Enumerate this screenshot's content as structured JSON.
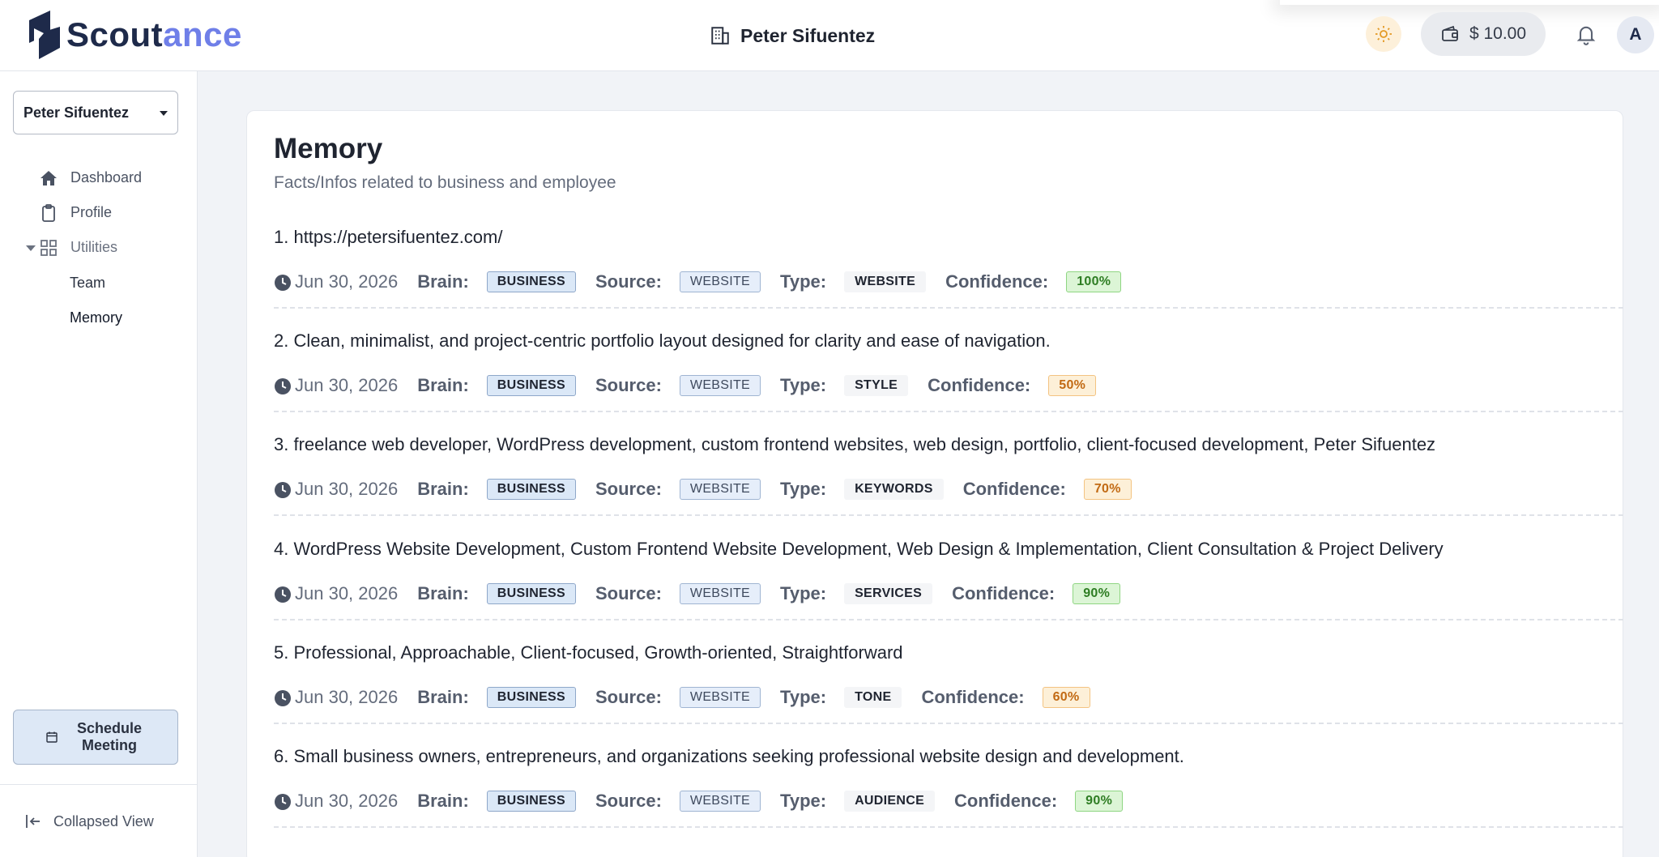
{
  "brand": {
    "name_part1": "Scout",
    "name_part2": "ance"
  },
  "header": {
    "company_name": "Peter Sifuentez",
    "wallet_balance": "$ 10.00",
    "avatar_initial": "A"
  },
  "sidebar": {
    "business_select": "Peter Sifuentez",
    "nav": [
      {
        "label": "Dashboard",
        "icon": "home-icon"
      },
      {
        "label": "Profile",
        "icon": "clipboard-icon"
      },
      {
        "label": "Utilities",
        "icon": "grid-icon"
      }
    ],
    "sub_items": [
      {
        "label": "Team"
      },
      {
        "label": "Memory"
      }
    ],
    "schedule_label": "Schedule Meeting",
    "collapse_label": "Collapsed View"
  },
  "page": {
    "title": "Memory",
    "subtitle": "Facts/Infos related to business and employee"
  },
  "labels": {
    "brain": "Brain:",
    "source": "Source:",
    "type": "Type:",
    "confidence": "Confidence:"
  },
  "memories": [
    {
      "text": "1. https://petersifuentez.com/",
      "date": "Jun 30, 2026",
      "brain": "BUSINESS",
      "source": "WEBSITE",
      "type": "WEBSITE",
      "confidence": "100%",
      "level": "green"
    },
    {
      "text": "2. Clean, minimalist, and project-centric portfolio layout designed for clarity and ease of navigation.",
      "date": "Jun 30, 2026",
      "brain": "BUSINESS",
      "source": "WEBSITE",
      "type": "STYLE",
      "confidence": "50%",
      "level": "orange"
    },
    {
      "text": "3. freelance web developer, WordPress development, custom frontend websites, web design, portfolio, client-focused development, Peter Sifuentez",
      "date": "Jun 30, 2026",
      "brain": "BUSINESS",
      "source": "WEBSITE",
      "type": "KEYWORDS",
      "confidence": "70%",
      "level": "orange"
    },
    {
      "text": "4. WordPress Website Development, Custom Frontend Website Development, Web Design & Implementation, Client Consultation & Project Delivery",
      "date": "Jun 30, 2026",
      "brain": "BUSINESS",
      "source": "WEBSITE",
      "type": "SERVICES",
      "confidence": "90%",
      "level": "green"
    },
    {
      "text": "5. Professional, Approachable, Client-focused, Growth-oriented, Straightforward",
      "date": "Jun 30, 2026",
      "brain": "BUSINESS",
      "source": "WEBSITE",
      "type": "TONE",
      "confidence": "60%",
      "level": "orange"
    },
    {
      "text": "6. Small business owners, entrepreneurs, and organizations seeking professional website design and development.",
      "date": "Jun 30, 2026",
      "brain": "BUSINESS",
      "source": "WEBSITE",
      "type": "AUDIENCE",
      "confidence": "90%",
      "level": "green"
    }
  ]
}
